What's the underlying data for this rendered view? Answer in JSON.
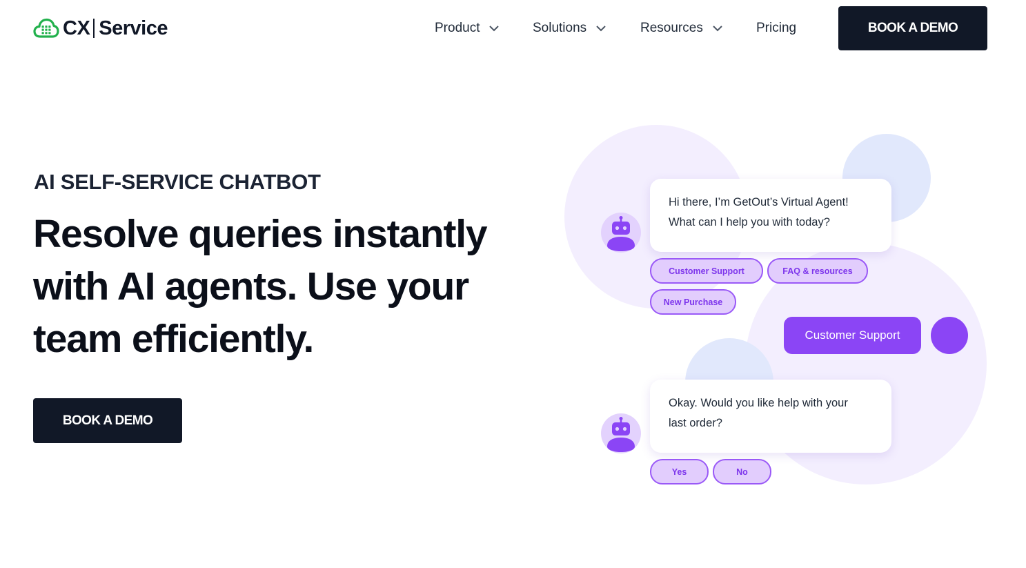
{
  "header": {
    "logo": {
      "icon": "cloud-grid-icon",
      "brand_cx": "CX",
      "brand_service": "Service"
    },
    "nav": [
      {
        "label": "Product",
        "has_dropdown": true
      },
      {
        "label": "Solutions",
        "has_dropdown": true
      },
      {
        "label": "Resources",
        "has_dropdown": true
      },
      {
        "label": "Pricing",
        "has_dropdown": false
      }
    ],
    "cta_label": "BOOK A DEMO"
  },
  "hero": {
    "eyebrow": "AI SELF-SERVICE CHATBOT",
    "headline_lines": [
      "Resolve queries instantly",
      "with AI agents. Use your",
      "team efficiently."
    ],
    "cta_label": "BOOK A DEMO"
  },
  "chat": {
    "bot_message_1": [
      "Hi there, I’m GetOut’s Virtual Agent!",
      "What can I help you with today?"
    ],
    "options_1": [
      "Customer Support",
      "FAQ & resources",
      "New Purchase"
    ],
    "user_message": "Customer Support",
    "bot_message_2": [
      "Okay. Would you like help with your",
      "last order?"
    ],
    "options_2": [
      "Yes",
      "No"
    ],
    "bot_avatar_icon": "robot-icon"
  },
  "colors": {
    "brand_green": "#22b14c",
    "dark_navy": "#111827",
    "accent_purple": "#8b45f5",
    "chip_fill": "#e2cdfd",
    "blob_lavender": "#f3eefe",
    "blob_blue": "#e1e8fc"
  }
}
